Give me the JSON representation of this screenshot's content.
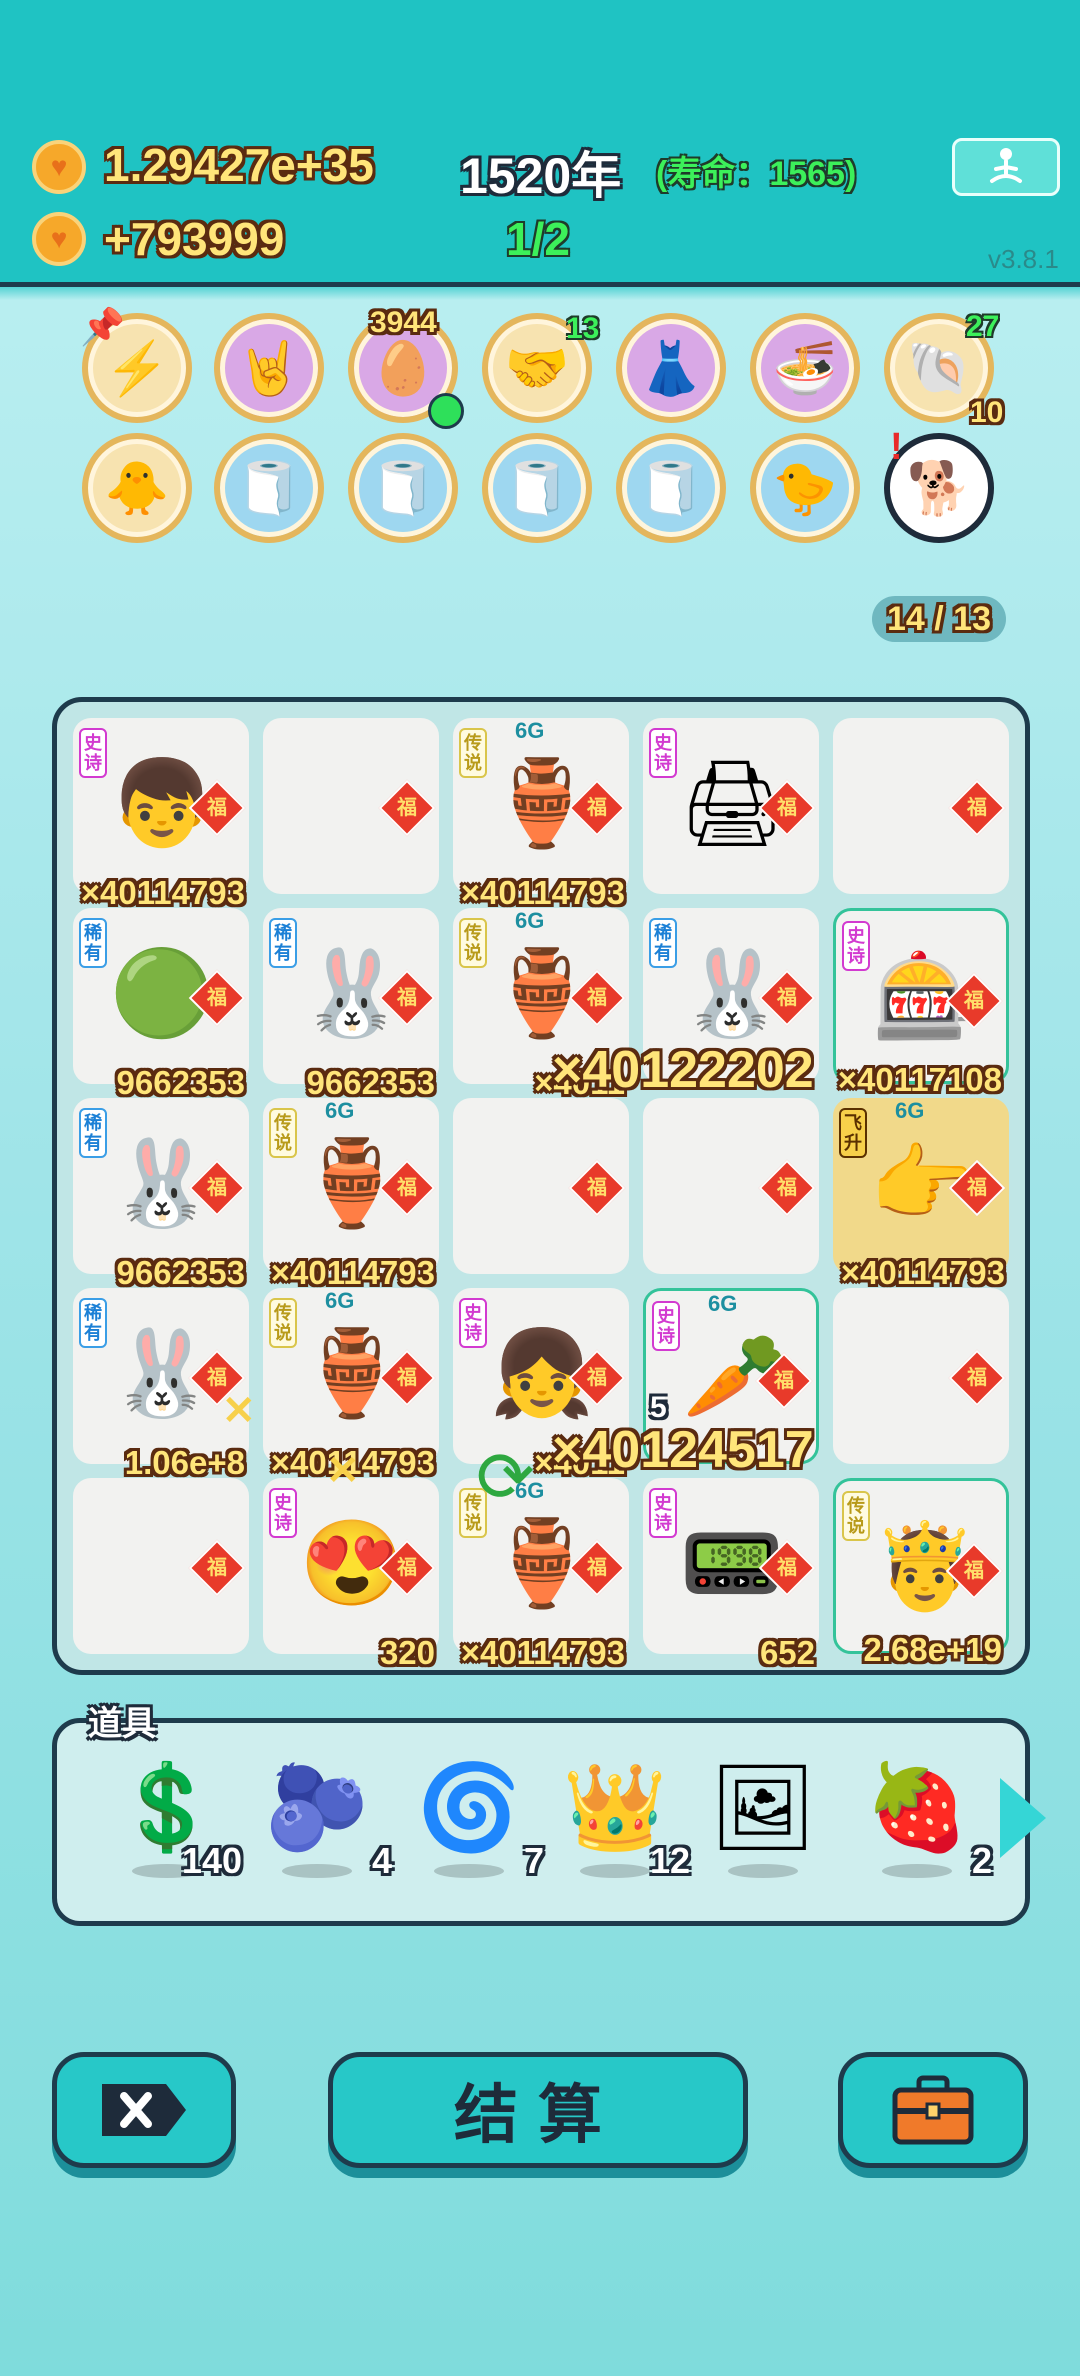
{
  "header": {
    "coins_total": "1.29427e+35",
    "coins_rate": "+793999",
    "year": "1520年",
    "lifespan": "(寿命：1565)",
    "progress": "1/2",
    "version": "v3.8.1",
    "meditate_icon": "meditation-icon"
  },
  "buffs": {
    "row1": [
      {
        "icon": "lightning-icon",
        "glyph": "⚡",
        "count": ""
      },
      {
        "icon": "rock-hand-icon",
        "glyph": "🤘",
        "count": ""
      },
      {
        "icon": "egg-tray-icon",
        "glyph": "🥚",
        "count": "3944"
      },
      {
        "icon": "handshake-icon",
        "glyph": "🤝",
        "count": "13"
      },
      {
        "icon": "skirt-icon",
        "glyph": "👗",
        "count": ""
      },
      {
        "icon": "bowls-icon",
        "glyph": "🍜",
        "count": ""
      },
      {
        "icon": "shell-icon",
        "glyph": "🐚",
        "count": "27",
        "count2": "10"
      }
    ],
    "row2": [
      {
        "icon": "chick-icon",
        "glyph": "🐥"
      },
      {
        "icon": "tissue-box-icon",
        "glyph": "🧻"
      },
      {
        "icon": "tissue-box-icon",
        "glyph": "🧻"
      },
      {
        "icon": "tissue-box-icon",
        "glyph": "🧻"
      },
      {
        "icon": "tissue-box-icon",
        "glyph": "🧻"
      },
      {
        "icon": "chick-syringe-icon",
        "glyph": "🐤"
      },
      {
        "icon": "cool-dog-icon",
        "glyph": "🐕"
      }
    ]
  },
  "slot_counter": "14 / 13",
  "fu_label": "福",
  "g6_label": "6G",
  "board": [
    [
      {
        "tag": "史诗",
        "tag_class": "epic",
        "glyph": "👦",
        "icon": "boy-face-icon",
        "mult": "×40114793",
        "g6": false
      },
      {
        "tag": "",
        "glyph": "",
        "icon": "",
        "mult": "",
        "g6": false
      },
      {
        "tag": "传说",
        "tag_class": "legend",
        "glyph": "🏺",
        "icon": "green-vase-icon",
        "mult": "×40114793",
        "g6": true
      },
      {
        "tag": "史诗",
        "tag_class": "epic",
        "glyph": "🖨",
        "icon": "printer-icon",
        "mult": "",
        "g6": false
      },
      {
        "tag": "",
        "glyph": "",
        "icon": "",
        "mult": "",
        "g6": false
      }
    ],
    [
      {
        "tag": "稀有",
        "tag_class": "rare",
        "glyph": "🟢",
        "icon": "green-refresh-ball-icon",
        "mult": "9662353",
        "g6": false
      },
      {
        "tag": "稀有",
        "tag_class": "rare",
        "glyph": "🐰",
        "icon": "rabbit-icon",
        "mult": "9662353",
        "g6": false
      },
      {
        "tag": "传说",
        "tag_class": "legend",
        "glyph": "🏺",
        "icon": "green-vase-icon",
        "mult": "×4011",
        "g6": true
      },
      {
        "tag": "稀有",
        "tag_class": "rare",
        "glyph": "🐰",
        "icon": "rabbit-icon",
        "mult": "",
        "g6": false
      },
      {
        "tag": "史诗",
        "tag_class": "epic",
        "glyph": "🎰",
        "icon": "capsule-machine-icon",
        "mult": "×40117108",
        "g6": false,
        "hl": true
      }
    ],
    [
      {
        "tag": "稀有",
        "tag_class": "rare",
        "glyph": "🐰",
        "icon": "rabbit-icon",
        "mult": "9662353",
        "g6": false
      },
      {
        "tag": "传说",
        "tag_class": "legend",
        "glyph": "🏺",
        "icon": "green-vase-icon",
        "mult": "×40114793",
        "g6": true
      },
      {
        "tag": "",
        "glyph": "",
        "icon": "",
        "mult": "",
        "g6": false
      },
      {
        "tag": "",
        "glyph": "",
        "icon": "",
        "mult": "",
        "g6": false
      },
      {
        "tag": "飞升",
        "tag_class": "ascend",
        "glyph": "👉",
        "icon": "pointing-hand-icon",
        "mult": "×40114793",
        "g6": true,
        "gold": true
      }
    ],
    [
      {
        "tag": "稀有",
        "tag_class": "rare",
        "glyph": "🐰",
        "icon": "rabbit-icon",
        "mult": "1.06e+8",
        "g6": false
      },
      {
        "tag": "传说",
        "tag_class": "legend",
        "glyph": "🏺",
        "icon": "green-vase-icon",
        "mult": "×40114793",
        "g6": true
      },
      {
        "tag": "史诗",
        "tag_class": "epic",
        "glyph": "👧",
        "icon": "girl-face-icon",
        "mult": "×4011",
        "g6": false
      },
      {
        "tag": "史诗",
        "tag_class": "epic",
        "glyph": "🥕",
        "icon": "crowned-carrot-icon",
        "mult": "",
        "g6": true,
        "hl": true,
        "level": "5"
      },
      {
        "tag": "",
        "glyph": "",
        "icon": "",
        "mult": "",
        "g6": false
      }
    ],
    [
      {
        "tag": "",
        "glyph": "",
        "icon": "",
        "mult": "",
        "g6": false
      },
      {
        "tag": "史诗",
        "tag_class": "epic",
        "glyph": "😍",
        "icon": "heart-eyes-face-icon",
        "mult": "320",
        "g6": false
      },
      {
        "tag": "传说",
        "tag_class": "legend",
        "glyph": "🏺",
        "icon": "green-vase-icon",
        "mult": "×40114793",
        "g6": true
      },
      {
        "tag": "史诗",
        "tag_class": "epic",
        "glyph": "📟",
        "icon": "graphics-card-icon",
        "mult": "652",
        "g6": false
      },
      {
        "tag": "传说",
        "tag_class": "legend",
        "glyph": "🤴",
        "icon": "crowned-king-icon",
        "mult": "2.68e+19",
        "g6": false,
        "hl": true
      }
    ]
  ],
  "big_multipliers": {
    "row2": "×40122202",
    "row4": "×40124517"
  },
  "items": {
    "label": "道具",
    "list": [
      {
        "icon": "dollar-coin-icon",
        "glyph": "💲",
        "count": "140"
      },
      {
        "icon": "blueberry-icon",
        "glyph": "🫐",
        "count": "4"
      },
      {
        "icon": "black-hole-icon",
        "glyph": "🌀",
        "count": "7"
      },
      {
        "icon": "crown-icon",
        "glyph": "👑",
        "count": "12"
      },
      {
        "icon": "framed-card-icon",
        "glyph": "🖼",
        "count": ""
      },
      {
        "icon": "strawberry-icon",
        "glyph": "🍓",
        "count": "2"
      }
    ]
  },
  "footer": {
    "settle_label": "结算",
    "exit_icon": "exit-x-icon",
    "bag_icon": "briefcase-icon"
  }
}
